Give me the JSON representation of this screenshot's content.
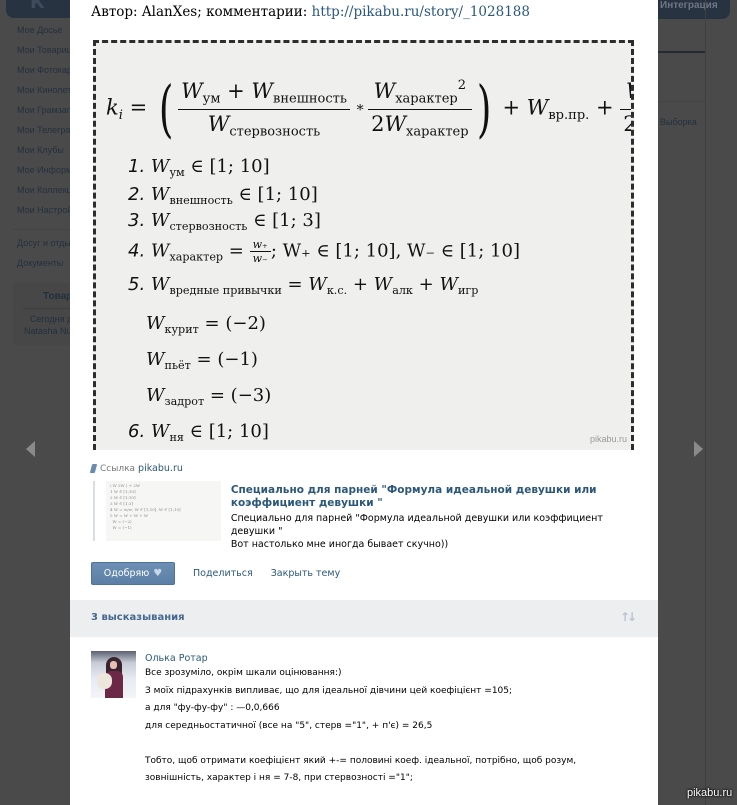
{
  "background": {
    "header_right_label": "Интеграция",
    "sidebar_items": [
      "Мое Досье",
      "Мои Товарищи",
      "Мои Фотокарточки",
      "Мои Кинолетописи",
      "Мои Грамзаписи",
      "Мои Телеграммы",
      "Мои Клубы",
      "Мое Информбюро",
      "Мои Коллекции",
      "Мои Настройки"
    ],
    "sidebar_extra_items": [
      "Досуг и отдых",
      "Документы"
    ],
    "box_title": "Товарищи",
    "box_lines": [
      "Сегодня день рождения",
      "Natasha Nu"
    ],
    "right_label": "Выборка"
  },
  "post": {
    "author_text": "Автор: AlanXes; комментарии: ",
    "author_link": "http://pikabu.ru/story/_1028188",
    "image_watermark": "pikabu.ru",
    "formula": {
      "lhs": "k",
      "lhs_sub": "i",
      "w_um": "ум",
      "w_vneshnost": "внешность",
      "w_sterv": "стервозность",
      "w_harakter": "характер",
      "w_vrpr": "вр.пр.",
      "w_nya": "ня",
      "items": [
        {
          "n": "1.",
          "sub": "ум",
          "rest": " ∈ [1; 10]"
        },
        {
          "n": "2.",
          "sub": "внешность",
          "rest": " ∈ [1; 10]"
        },
        {
          "n": "3.",
          "sub": "стервозность",
          "rest": " ∈ [1; 3]"
        },
        {
          "n": "4.",
          "sub": "характер",
          "rest": "; W₊ ∈ [1; 10], W₋ ∈ [1; 10]"
        },
        {
          "n": "5.",
          "sub": "вредные привычки",
          "rest": " = W к.с. + W алк + W игр"
        },
        {
          "n": "",
          "sub": "курит",
          "rest": " = (−2)"
        },
        {
          "n": "",
          "sub": "пьёт",
          "rest": " = (−1)"
        },
        {
          "n": "",
          "sub": "задрот",
          "rest": " = (−3)"
        },
        {
          "n": "6.",
          "sub": "ня",
          "rest": " ∈ [1; 10]"
        }
      ],
      "item5_terms": [
        "к.с.",
        "алк",
        "игр"
      ]
    },
    "link": {
      "prefix": "Ссылка",
      "domain": "pikabu.ru",
      "title": "Специально для парней \"Формула идеальной девушки или коэффициент девушки \"",
      "desc_line1": "Специально для парней \"Формула идеальной девушки или коэффициент девушки \"",
      "desc_line2": "Вот настолько мне иногда бывает скучно))"
    },
    "actions": {
      "like_label": "Одобряю",
      "share_label": "Поделиться",
      "close_label": "Закрыть тему"
    }
  },
  "comments": {
    "count_label": "3 высказывания",
    "items": [
      {
        "author": "Олька Ротар",
        "lines": [
          "Все зрозуміло, окрім шкали оцінювання:)",
          "З моїх підрахунків випливає, що для ідеальної дівчини цей коефіцієнт =105;",
          "а для \"фу-фу-фу\" : —0,0,666",
          "для середньостатичної (все на \"5\", стерв =\"1\", + п'є) = 26,5",
          "",
          "Тобто, щоб отримати коефіцієнт який +-= половині коеф. ідеальної, потрібно, щоб розум,",
          "зовнішність, характер і ня = 7-8, при стервозності =\"1\";"
        ]
      }
    ]
  },
  "watermark": "pikabu.ru"
}
